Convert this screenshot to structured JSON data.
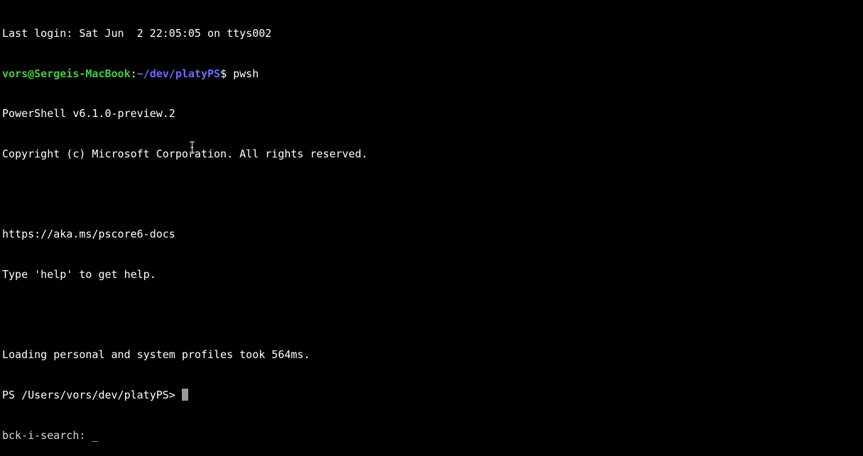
{
  "terminal": {
    "last_login": "Last login: Sat Jun  2 22:05:05 on ttys002",
    "prompt": {
      "user_host": "vors@Sergeis-MacBook",
      "colon": ":",
      "path": "~/dev/platyPS",
      "dollar": "$ ",
      "command": "pwsh"
    },
    "banner_version": "PowerShell v6.1.0-preview.2",
    "banner_copyright": "Copyright (c) Microsoft Corporation. All rights reserved.",
    "docs_url": "https://aka.ms/pscore6-docs",
    "help_hint": "Type 'help' to get help.",
    "profile_load": "Loading personal and system profiles took 564ms.",
    "ps_prompt": "PS /Users/vors/dev/platyPS> ",
    "reverse_search": "bck-i-search: _"
  },
  "colors": {
    "background": "#000000",
    "text": "#ffffff",
    "user_host": "#3fcf3f",
    "path": "#6b6bff",
    "cursor": "#9a9a9a"
  },
  "icons": {
    "mouse_pointer": "text-ibeam-cursor-icon"
  }
}
